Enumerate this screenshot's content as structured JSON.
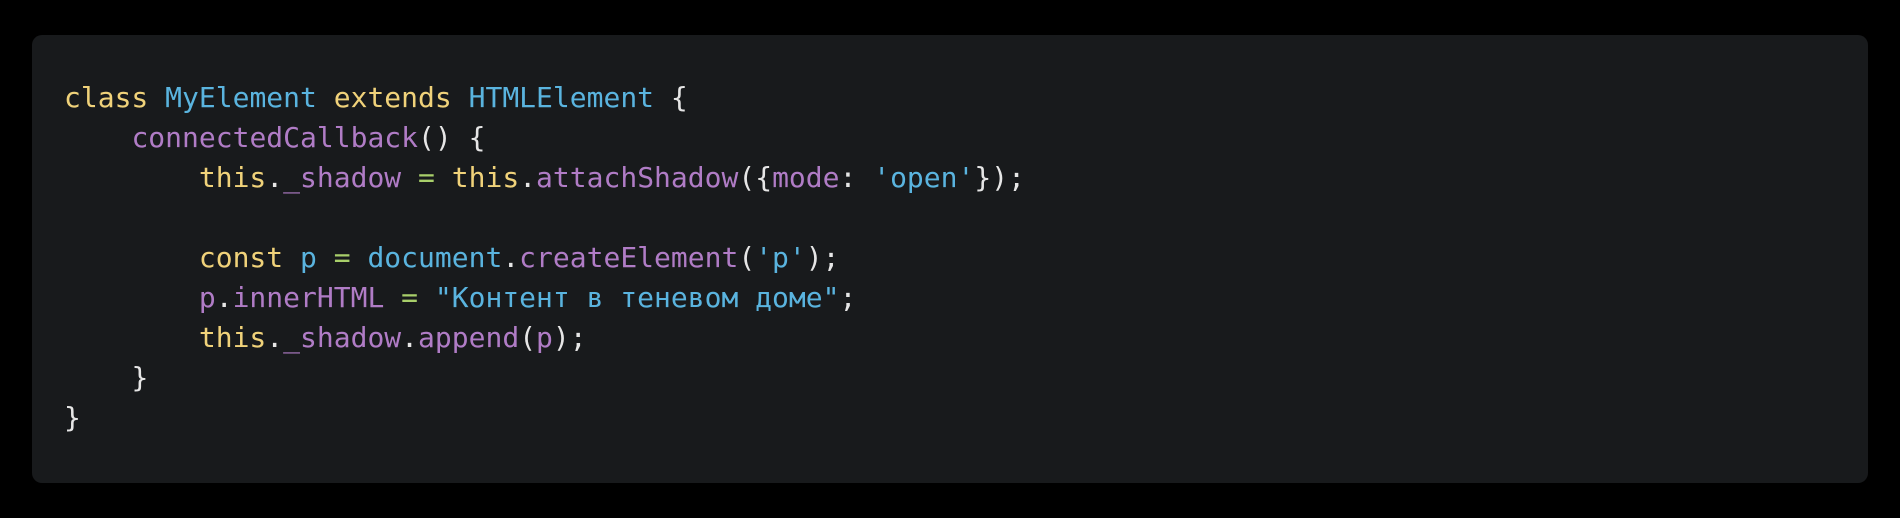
{
  "code": {
    "colors": {
      "background": "#000000",
      "panel": "#181a1c",
      "keyword": "#f0d27a",
      "class_name": "#5ab4df",
      "function": "#b07cc6",
      "string": "#5ab4df",
      "text": "#e6e6e6",
      "operator": "#a8cf6a"
    },
    "lines": [
      {
        "indent": 0,
        "tokens": [
          {
            "t": "class",
            "c": "kw"
          },
          {
            "t": " ",
            "c": "punct"
          },
          {
            "t": "MyElement",
            "c": "cls"
          },
          {
            "t": " ",
            "c": "punct"
          },
          {
            "t": "extends",
            "c": "kw"
          },
          {
            "t": " ",
            "c": "punct"
          },
          {
            "t": "HTMLElement",
            "c": "cls"
          },
          {
            "t": " {",
            "c": "punct"
          }
        ]
      },
      {
        "indent": 1,
        "tokens": [
          {
            "t": "connectedCallback",
            "c": "func"
          },
          {
            "t": "() {",
            "c": "punct"
          }
        ]
      },
      {
        "indent": 2,
        "tokens": [
          {
            "t": "this",
            "c": "kw"
          },
          {
            "t": ".",
            "c": "punct"
          },
          {
            "t": "_shadow",
            "c": "prop"
          },
          {
            "t": " ",
            "c": "punct"
          },
          {
            "t": "=",
            "c": "eq"
          },
          {
            "t": " ",
            "c": "punct"
          },
          {
            "t": "this",
            "c": "kw"
          },
          {
            "t": ".",
            "c": "punct"
          },
          {
            "t": "attachShadow",
            "c": "func"
          },
          {
            "t": "({",
            "c": "punct"
          },
          {
            "t": "mode",
            "c": "prop"
          },
          {
            "t": ": ",
            "c": "punct"
          },
          {
            "t": "'open'",
            "c": "str"
          },
          {
            "t": "});",
            "c": "punct"
          }
        ]
      },
      {
        "indent": 0,
        "tokens": []
      },
      {
        "indent": 2,
        "tokens": [
          {
            "t": "const",
            "c": "kw"
          },
          {
            "t": " ",
            "c": "punct"
          },
          {
            "t": "p",
            "c": "var"
          },
          {
            "t": " ",
            "c": "punct"
          },
          {
            "t": "=",
            "c": "eq"
          },
          {
            "t": " ",
            "c": "punct"
          },
          {
            "t": "document",
            "c": "var"
          },
          {
            "t": ".",
            "c": "punct"
          },
          {
            "t": "createElement",
            "c": "func"
          },
          {
            "t": "(",
            "c": "punct"
          },
          {
            "t": "'p'",
            "c": "str"
          },
          {
            "t": ");",
            "c": "punct"
          }
        ]
      },
      {
        "indent": 2,
        "tokens": [
          {
            "t": "p",
            "c": "prop"
          },
          {
            "t": ".",
            "c": "punct"
          },
          {
            "t": "innerHTML",
            "c": "prop"
          },
          {
            "t": " ",
            "c": "punct"
          },
          {
            "t": "=",
            "c": "eq"
          },
          {
            "t": " ",
            "c": "punct"
          },
          {
            "t": "\"Контент в теневом доме\"",
            "c": "str"
          },
          {
            "t": ";",
            "c": "punct"
          }
        ]
      },
      {
        "indent": 2,
        "tokens": [
          {
            "t": "this",
            "c": "kw"
          },
          {
            "t": ".",
            "c": "punct"
          },
          {
            "t": "_shadow",
            "c": "prop"
          },
          {
            "t": ".",
            "c": "punct"
          },
          {
            "t": "append",
            "c": "func"
          },
          {
            "t": "(",
            "c": "punct"
          },
          {
            "t": "p",
            "c": "prop"
          },
          {
            "t": ");",
            "c": "punct"
          }
        ]
      },
      {
        "indent": 1,
        "tokens": [
          {
            "t": "}",
            "c": "punct"
          }
        ]
      },
      {
        "indent": 0,
        "tokens": [
          {
            "t": "}",
            "c": "punct"
          }
        ]
      }
    ]
  }
}
